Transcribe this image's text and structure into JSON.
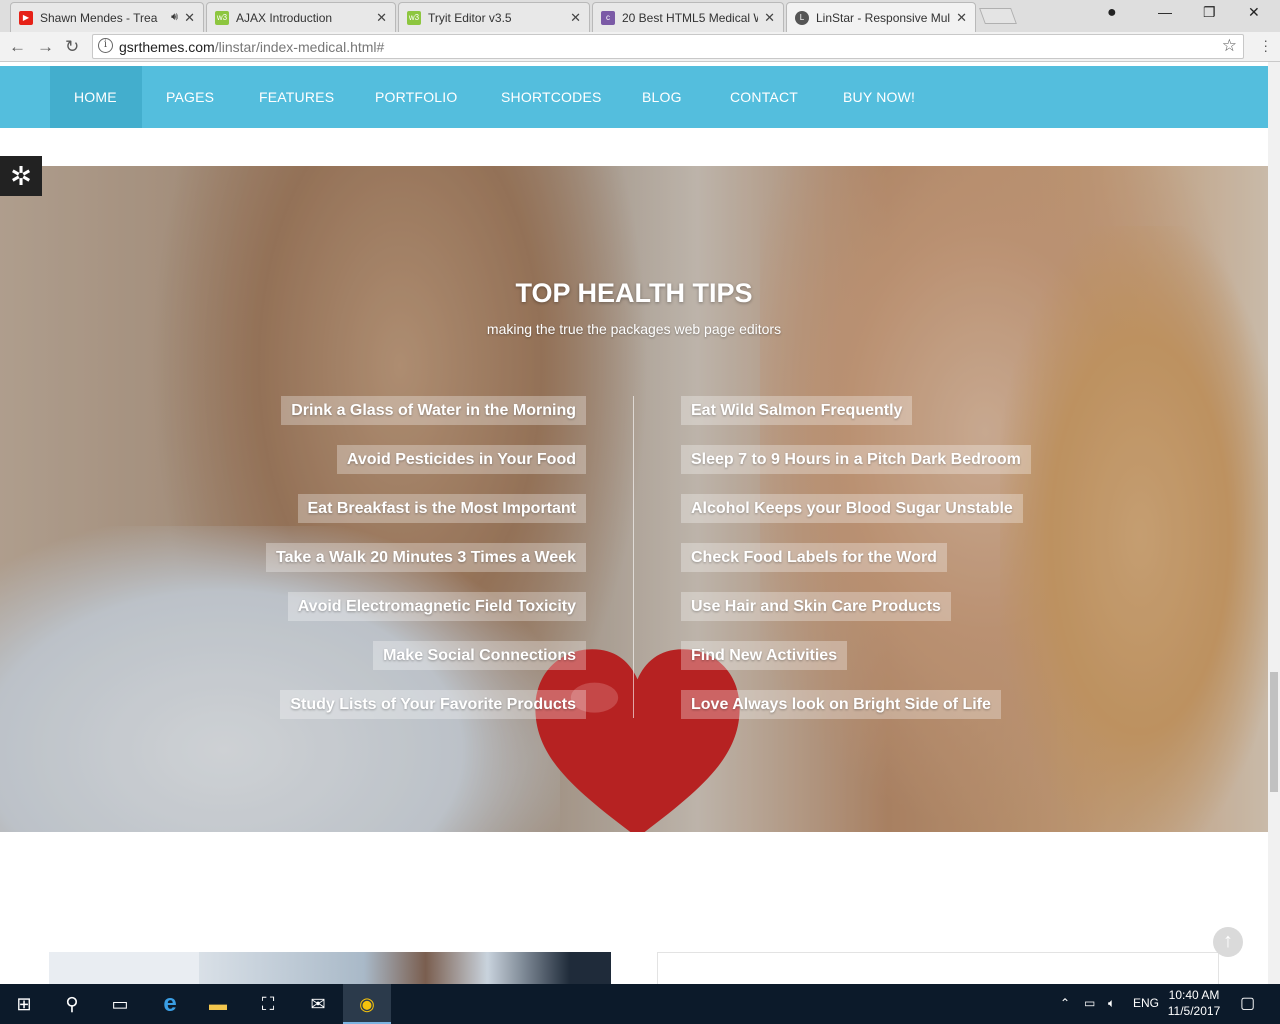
{
  "browser": {
    "tabs": [
      {
        "title": "Shawn Mendes - Trea",
        "favicon": "youtube-icon",
        "color": "#e62117",
        "audio": true
      },
      {
        "title": "AJAX Introduction",
        "favicon": "w3schools-icon",
        "color": "#8dc63f"
      },
      {
        "title": "Tryit Editor v3.5",
        "favicon": "w3schools-icon",
        "color": "#8dc63f"
      },
      {
        "title": "20 Best HTML5 Medical W",
        "favicon": "colorlib-icon",
        "color": "#7b5aa6"
      },
      {
        "title": "LinStar - Responsive Mul",
        "favicon": "letter-l-icon",
        "color": "#555555",
        "active": true
      }
    ],
    "url_host": "gsrthemes.com",
    "url_path": "/linstar/index-medical.html#"
  },
  "nav": {
    "items": [
      "HOME",
      "PAGES",
      "FEATURES",
      "PORTFOLIO",
      "SHORTCODES",
      "BLOG",
      "CONTACT",
      "BUY NOW!"
    ],
    "active": "HOME",
    "color": "#54bedd"
  },
  "hero": {
    "title": "TOP HEALTH TIPS",
    "subtitle": "making the true the packages web page editors",
    "tips_left": [
      "Drink a Glass of Water in the Morning",
      "Avoid Pesticides in Your Food",
      "Eat Breakfast is the Most Important",
      "Take a Walk 20 Minutes 3 Times a Week",
      "Avoid Electromagnetic Field Toxicity",
      "Make Social Connections",
      "Study Lists of Your Favorite Products"
    ],
    "tips_right": [
      "Eat Wild Salmon Frequently",
      "Sleep 7 to 9 Hours in a Pitch Dark Bedroom",
      "Alcohol Keeps your Blood Sugar Unstable",
      "Check Food Labels for the Word",
      "Use Hair and Skin Care Products",
      "Find New Activities",
      "Love Always look on Bright Side of Life"
    ]
  },
  "taskbar": {
    "language": "ENG",
    "time": "10:40 AM",
    "date": "11/5/2017"
  }
}
